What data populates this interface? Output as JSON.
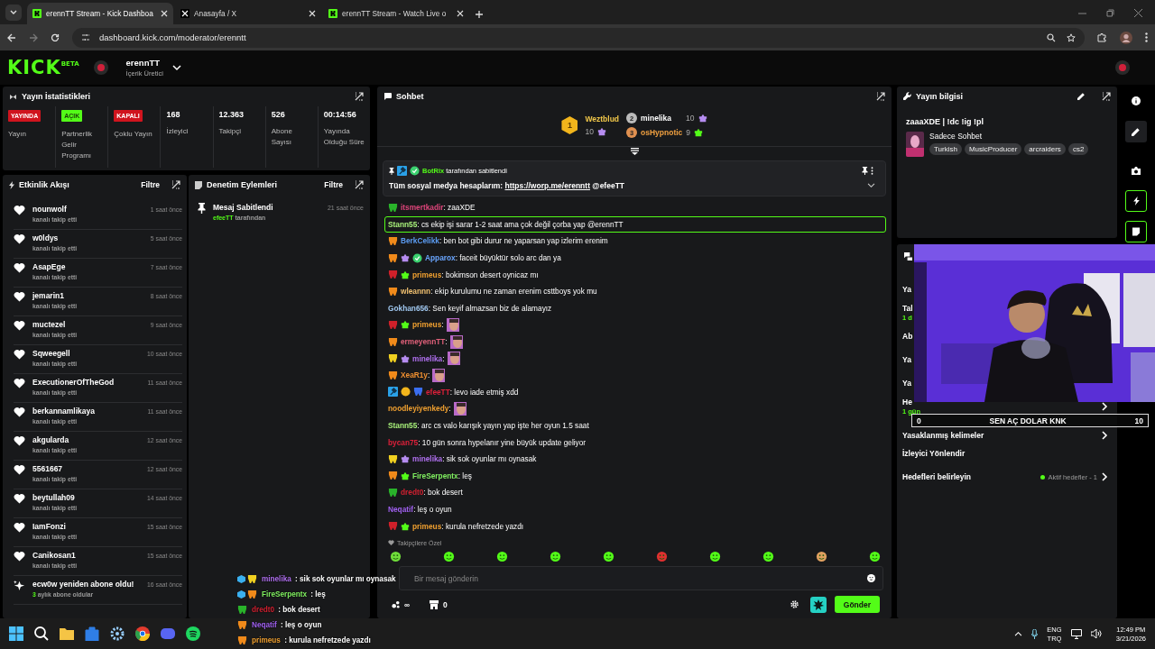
{
  "browser": {
    "tabs": [
      {
        "title": "erennTT Stream - Kick Dashboa",
        "selected": true
      },
      {
        "title": "Anasayfa / X",
        "selected": false
      },
      {
        "title": "erennTT Stream - Watch Live o",
        "selected": false
      }
    ],
    "url": "dashboard.kick.com/moderator/erenntt"
  },
  "header": {
    "logo": "KICK",
    "logo_tag": "BETA",
    "channel": "erennTT",
    "role": "İçerik Üretici"
  },
  "stats": {
    "title": "Yayın İstatistikleri",
    "items": [
      {
        "kind": "status",
        "badge": "YAYINDA",
        "color": "#d0141e",
        "label": "Yayın"
      },
      {
        "kind": "status",
        "badge": "AÇIK",
        "color": "#53fc18",
        "label": "Partnerlik Gelir Programı"
      },
      {
        "kind": "status",
        "badge": "KAPALI",
        "color": "#d0141e",
        "label": "Çoklu Yayın"
      },
      {
        "kind": "number",
        "value": "168",
        "label": "İzleyici"
      },
      {
        "kind": "number",
        "value": "12.363",
        "label": "Takipçi"
      },
      {
        "kind": "number",
        "value": "526",
        "label": "Abone Sayısı"
      },
      {
        "kind": "number",
        "value": "00:14:56",
        "label": "Yayında Olduğu Süre"
      }
    ]
  },
  "activity": {
    "title": "Etkinlik Akışı",
    "filter": "Filtre",
    "items": [
      {
        "kind": "follow",
        "name": "nounwolf",
        "text": "kanalı takip etti",
        "time": "1 saat önce"
      },
      {
        "kind": "follow",
        "name": "w0ldys",
        "text": "kanalı takip etti",
        "time": "5 saat önce"
      },
      {
        "kind": "follow",
        "name": "AsapEge",
        "text": "kanalı takip etti",
        "time": "7 saat önce"
      },
      {
        "kind": "follow",
        "name": "jemarin1",
        "text": "kanalı takip etti",
        "time": "8 saat önce"
      },
      {
        "kind": "follow",
        "name": "muctezel",
        "text": "kanalı takip etti",
        "time": "9 saat önce"
      },
      {
        "kind": "follow",
        "name": "Sqweegell",
        "text": "kanalı takip etti",
        "time": "10 saat önce"
      },
      {
        "kind": "follow",
        "name": "ExecutionerOfTheGod",
        "text": "kanalı takip etti",
        "time": "11 saat önce"
      },
      {
        "kind": "follow",
        "name": "berkannamlikaya",
        "text": "kanalı takip etti",
        "time": "11 saat önce"
      },
      {
        "kind": "follow",
        "name": "akgularda",
        "text": "kanalı takip etti",
        "time": "12 saat önce"
      },
      {
        "kind": "follow",
        "name": "5561667",
        "text": "kanalı takip etti",
        "time": "12 saat önce"
      },
      {
        "kind": "follow",
        "name": "beytullah09",
        "text": "kanalı takip etti",
        "time": "14 saat önce"
      },
      {
        "kind": "follow",
        "name": "IamFonzi",
        "text": "kanalı takip etti",
        "time": "15 saat önce"
      },
      {
        "kind": "follow",
        "name": "Canikosan1",
        "text": "kanalı takip etti",
        "time": "15 saat önce"
      },
      {
        "kind": "resub",
        "name": "ecw0w yeniden abone oldu!",
        "count": "3",
        "text": "aylık abone oldular",
        "time": "16 saat önce"
      }
    ]
  },
  "moderation": {
    "title": "Denetim Eylemleri",
    "filter": "Filtre",
    "items": [
      {
        "title": "Mesaj Sabitlendi",
        "by": "efeeTT",
        "by_suffix": "tarafından",
        "time": "21 saat önce"
      }
    ]
  },
  "chat": {
    "title": "Sohbet",
    "leaders": [
      {
        "name": "Weztblud",
        "count": "10",
        "rank": "1"
      },
      {
        "name": "minelika",
        "count": "10",
        "rank": "2"
      },
      {
        "name": "osHypnotic",
        "count": "9",
        "rank": "3"
      }
    ],
    "pinned": {
      "badges": [
        {
          "kind": "mod"
        },
        {
          "kind": "verified"
        }
      ],
      "by": "BotRix",
      "by_suffix": "tarafından sabitlendi",
      "text": "Tüm sosyal medya hesaplarım:",
      "link": "https://worp.me/erenntt",
      "mention": "@efeeTT"
    },
    "messages": [
      {
        "badges": [
          {
            "kind": "sub-green"
          }
        ],
        "name": "itsmertkadir",
        "color": "#e0457b",
        "text": ": zaaXDE",
        "highlighted": false
      },
      {
        "name": "Stann55",
        "color": "#a8f07a",
        "text": ": cs ekip işi sarar 1-2 saat ama çok değil çorba yap @erennTT",
        "highlighted": true
      },
      {
        "badges": [
          {
            "kind": "sub-orange"
          }
        ],
        "name": "BerkCelikk",
        "color": "#5b9bf0",
        "text": ": ben bot gibi durur ne yaparsan yap izlerim erenim",
        "highlighted": false
      },
      {
        "badges": [
          {
            "kind": "sub-orange"
          },
          {
            "kind": "gift-purple"
          },
          {
            "kind": "verified"
          }
        ],
        "name": "Apparox",
        "color": "#6aa6ff",
        "text": ": faceit büyüktür solo arc dan ya",
        "highlighted": false
      },
      {
        "badges": [
          {
            "kind": "sub-red"
          },
          {
            "kind": "gift-green"
          }
        ],
        "name": "primeus",
        "color": "#f0a030",
        "text": ": bokimson desert oynicaz mı",
        "highlighted": false
      },
      {
        "badges": [
          {
            "kind": "sub-orange"
          }
        ],
        "name": "wleannn",
        "color": "#f0c070",
        "text": ": ekip kurulumu ne zaman erenim csttboys yok mu",
        "highlighted": false
      },
      {
        "name": "Gokhan656",
        "color": "#a0c8f0",
        "text": ": Sen keyif almazsan biz de alamayız",
        "highlighted": false
      },
      {
        "badges": [
          {
            "kind": "sub-red"
          },
          {
            "kind": "gift-green"
          }
        ],
        "name": "primeus",
        "color": "#f0a030",
        "text": ":",
        "emote": true,
        "highlighted": false
      },
      {
        "badges": [
          {
            "kind": "sub-orange"
          }
        ],
        "name": "ermeyennTT",
        "color": "#e0607a",
        "text": ":",
        "emote": true,
        "highlighted": false
      },
      {
        "badges": [
          {
            "kind": "sub-yellow"
          },
          {
            "kind": "gift-purple"
          }
        ],
        "name": "minelika",
        "color": "#b070f0",
        "text": ":",
        "emote": true,
        "highlighted": false
      },
      {
        "badges": [
          {
            "kind": "sub-orange"
          }
        ],
        "name": "XeaR1y",
        "color": "#f09030",
        "text": ":",
        "emote": true,
        "highlighted": false
      },
      {
        "badges": [
          {
            "kind": "mod"
          },
          {
            "kind": "founder"
          },
          {
            "kind": "sub-blue"
          }
        ],
        "name": "efeeTT",
        "color": "#e0203a",
        "text": ": levo iade etmiş xdd",
        "highlighted": false
      },
      {
        "name": "noodleyiyenkedy",
        "color": "#f0a030",
        "text": ":",
        "emote": true,
        "highlighted": false
      },
      {
        "name": "Stann55",
        "color": "#a8f07a",
        "text": ": arc cs valo karışık yayın yap işte her oyun 1.5 saat",
        "highlighted": false
      },
      {
        "name": "bycan75",
        "color": "#e0203a",
        "text": ": 10 gün sonra hypelanır yine büyük update geliyor",
        "highlighted": false
      },
      {
        "badges": [
          {
            "kind": "sub-yellow"
          },
          {
            "kind": "gift-purple"
          }
        ],
        "name": "minelika",
        "color": "#b070f0",
        "text": ": sik sok oyunlar mı oynasak",
        "highlighted": false
      },
      {
        "badges": [
          {
            "kind": "sub-orange"
          },
          {
            "kind": "gift-green"
          }
        ],
        "name": "FireSerpentx",
        "color": "#80f060",
        "text": ": leş",
        "highlighted": false
      },
      {
        "badges": [
          {
            "kind": "sub-green"
          }
        ],
        "name": "dredt0",
        "color": "#d02030",
        "text": ": bok desert",
        "highlighted": false
      },
      {
        "name": "Neqatif",
        "color": "#a060f0",
        "text": ": leş o oyun",
        "highlighted": false
      },
      {
        "badges": [
          {
            "kind": "sub-red"
          },
          {
            "kind": "gift-green"
          }
        ],
        "name": "primeus",
        "color": "#f0a030",
        "text": ": kurula nefretzede yazdı",
        "highlighted": false
      }
    ],
    "followers_only": "Takipçilere Özel",
    "input": {
      "placeholder": "Bir mesaj gönderin"
    },
    "points": "∞",
    "store_count": "0",
    "send": "Gönder"
  },
  "stream_info": {
    "title": "Yayın bilgisi",
    "stream_title": "zaaaXDE | !dc !ig !pl",
    "category": "Sadece Sohbet",
    "tags": [
      "Turkish",
      "MusicProducer",
      "arcraiders",
      "cs2"
    ]
  },
  "settings": {
    "rows": [
      {
        "kind": "cut",
        "label": "Ya"
      },
      {
        "kind": "cut",
        "label": "Tal",
        "sub": "1 d"
      },
      {
        "kind": "cut",
        "label": "Ab"
      },
      {
        "kind": "cut",
        "label": "Ya"
      },
      {
        "kind": "cut",
        "label": "Ya"
      },
      {
        "kind": "nav",
        "label": "He",
        "sub": "1 gün"
      },
      {
        "kind": "nav",
        "label": "Yasaklanmış kelimeler"
      },
      {
        "kind": "plain",
        "label": "İzleyici Yönlendir"
      },
      {
        "kind": "nav",
        "label": "Hedefleri belirleyin",
        "status": "Aktif hedefler - 1"
      }
    ]
  },
  "overlay": {
    "goal": {
      "start": "0",
      "title": "SEN AÇ DOLAR KNK",
      "end": "10"
    },
    "chat": [
      {
        "name": "minelika",
        "color": "#b070f0",
        "text": ": sik sok oyunlar mı oynasak"
      },
      {
        "name": "FireSerpentx",
        "color": "#80f060",
        "text": ": leş"
      },
      {
        "name": "dredt0",
        "color": "#d02030",
        "text": ": bok desert"
      },
      {
        "name": "Neqatif",
        "color": "#a060f0",
        "text": ": leş o oyun"
      },
      {
        "name": "primeus",
        "color": "#f0a030",
        "text": ": kurula nefretzede yazdı"
      }
    ]
  },
  "taskbar": {
    "lang": "ENG",
    "layout": "TRQ",
    "time": "12:49 PM",
    "date": "3/21/2026"
  }
}
